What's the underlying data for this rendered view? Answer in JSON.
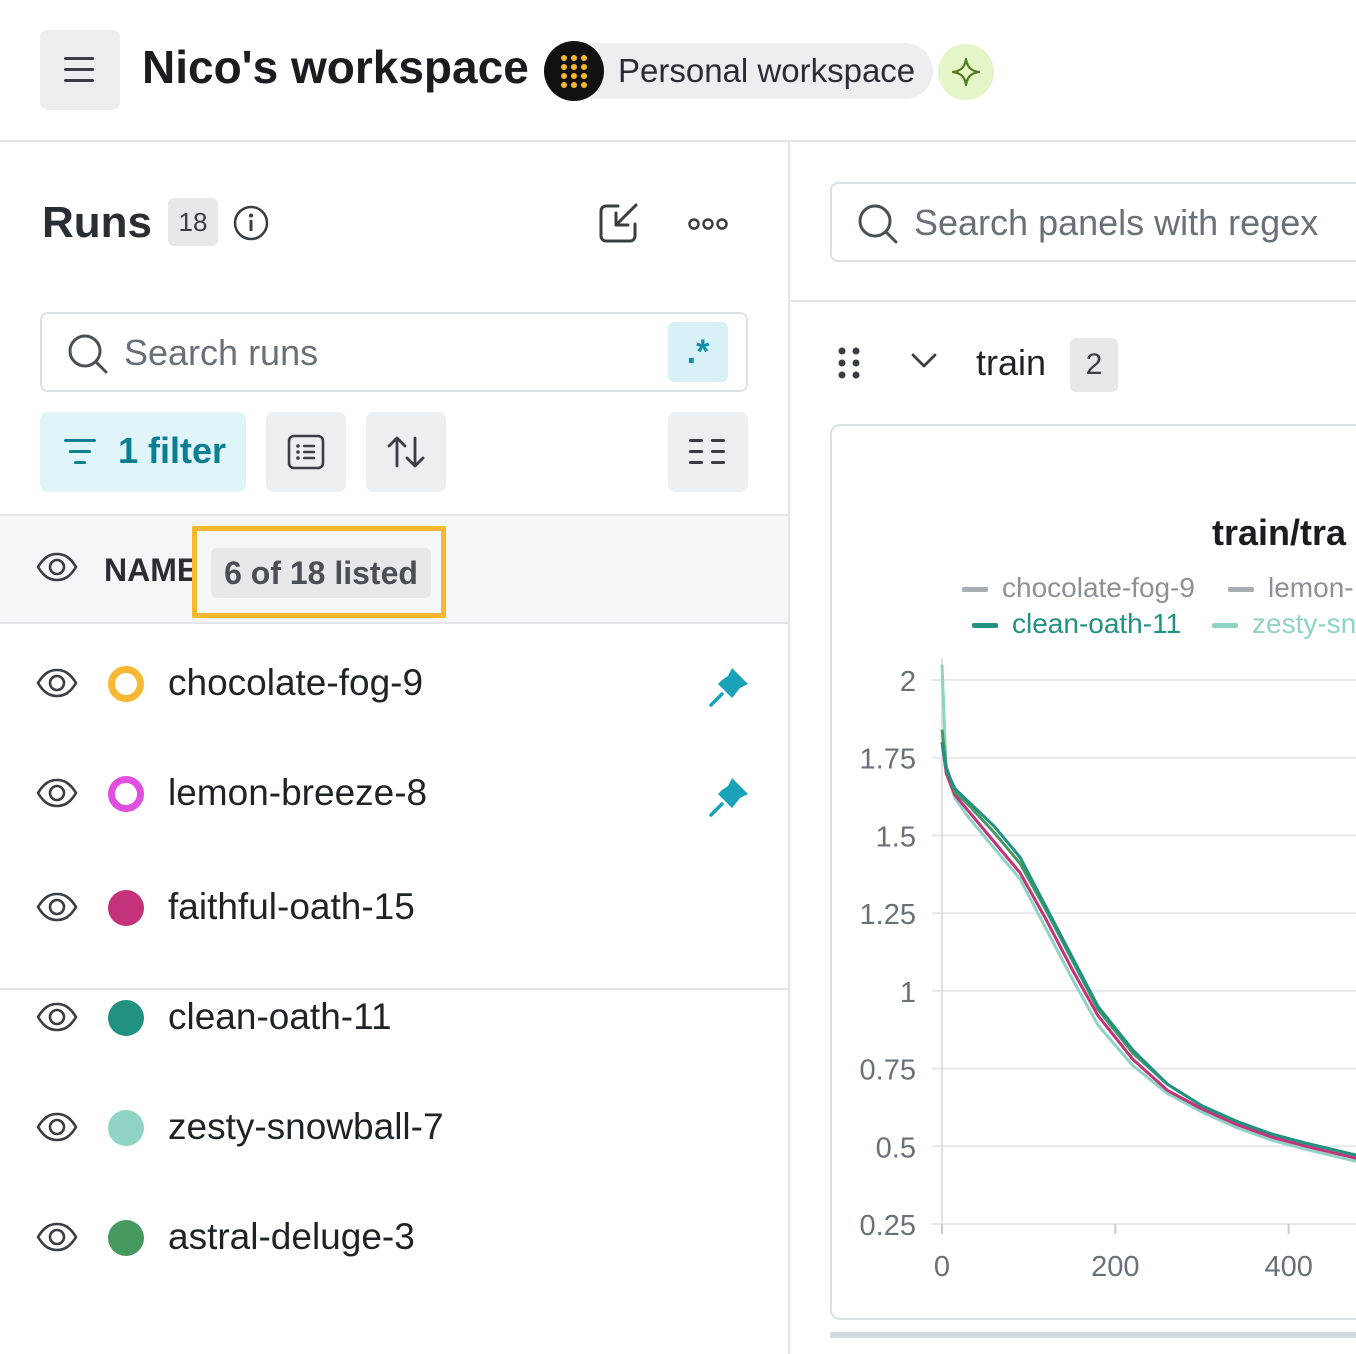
{
  "header": {
    "workspace_title": "Nico's workspace",
    "workspace_type": "Personal workspace"
  },
  "runs_panel": {
    "title": "Runs",
    "count": "18",
    "search_placeholder": "Search runs",
    "regex_label": ".*",
    "filter_label": "1 filter",
    "name_column": "NAME",
    "listed_badge": "6 of 18 listed",
    "runs": [
      {
        "name": "chocolate-fog-9",
        "color": "#f7b731",
        "style": "ring",
        "pinned": true
      },
      {
        "name": "lemon-breeze-8",
        "color": "#e04fe0",
        "style": "ring",
        "pinned": true
      },
      {
        "name": "faithful-oath-15",
        "color": "#c3327a",
        "style": "solid",
        "pinned": false
      },
      {
        "name": "clean-oath-11",
        "color": "#219181",
        "style": "solid",
        "pinned": false
      },
      {
        "name": "zesty-snowball-7",
        "color": "#8fd3c4",
        "style": "solid",
        "pinned": false
      },
      {
        "name": "astral-deluge-3",
        "color": "#479a5f",
        "style": "solid",
        "pinned": false
      }
    ]
  },
  "panels": {
    "search_placeholder": "Search panels with regex",
    "section_label": "train",
    "section_count": "2"
  },
  "chart_data": {
    "type": "line",
    "title": "train/tra",
    "legend": [
      {
        "name": "chocolate-fog-9",
        "color": "#a9adb3"
      },
      {
        "name": "lemon-",
        "color": "#a9adb3"
      },
      {
        "name": "clean-oath-11",
        "color": "#219181"
      },
      {
        "name": "zesty-sn",
        "color": "#8fd3c4"
      }
    ],
    "y_ticks": [
      "2",
      "1.75",
      "1.5",
      "1.25",
      "1",
      "0.75",
      "0.5",
      "0.25"
    ],
    "x_ticks": [
      "0",
      "200",
      "400"
    ],
    "xlim": [
      0,
      600
    ],
    "ylim": [
      0.25,
      2
    ],
    "series": [
      {
        "name": "zesty-snowball-7",
        "color": "#8fd3c4",
        "points": [
          [
            0,
            2.05
          ],
          [
            5,
            1.7
          ],
          [
            15,
            1.62
          ],
          [
            30,
            1.56
          ],
          [
            60,
            1.46
          ],
          [
            90,
            1.36
          ],
          [
            120,
            1.2
          ],
          [
            150,
            1.04
          ],
          [
            180,
            0.89
          ],
          [
            220,
            0.76
          ],
          [
            260,
            0.67
          ],
          [
            300,
            0.61
          ],
          [
            340,
            0.56
          ],
          [
            380,
            0.52
          ],
          [
            420,
            0.49
          ],
          [
            480,
            0.45
          ],
          [
            600,
            0.39
          ]
        ]
      },
      {
        "name": "faithful-oath-15",
        "color": "#c3327a",
        "points": [
          [
            0,
            1.8
          ],
          [
            5,
            1.7
          ],
          [
            15,
            1.63
          ],
          [
            30,
            1.58
          ],
          [
            60,
            1.48
          ],
          [
            90,
            1.38
          ],
          [
            120,
            1.23
          ],
          [
            150,
            1.07
          ],
          [
            180,
            0.92
          ],
          [
            220,
            0.78
          ],
          [
            260,
            0.68
          ],
          [
            300,
            0.62
          ],
          [
            340,
            0.57
          ],
          [
            380,
            0.53
          ],
          [
            420,
            0.5
          ],
          [
            480,
            0.46
          ],
          [
            600,
            0.4
          ]
        ]
      },
      {
        "name": "astral-deluge-3",
        "color": "#479a5f",
        "points": [
          [
            0,
            1.84
          ],
          [
            5,
            1.72
          ],
          [
            15,
            1.64
          ],
          [
            30,
            1.6
          ],
          [
            60,
            1.51
          ],
          [
            90,
            1.41
          ],
          [
            120,
            1.26
          ],
          [
            150,
            1.1
          ],
          [
            180,
            0.94
          ],
          [
            220,
            0.8
          ],
          [
            260,
            0.7
          ],
          [
            300,
            0.63
          ],
          [
            340,
            0.58
          ],
          [
            380,
            0.54
          ],
          [
            420,
            0.51
          ],
          [
            480,
            0.47
          ],
          [
            600,
            0.41
          ]
        ]
      },
      {
        "name": "clean-oath-11",
        "color": "#219181",
        "points": [
          [
            0,
            1.8
          ],
          [
            5,
            1.71
          ],
          [
            15,
            1.65
          ],
          [
            30,
            1.61
          ],
          [
            60,
            1.53
          ],
          [
            90,
            1.43
          ],
          [
            120,
            1.27
          ],
          [
            150,
            1.11
          ],
          [
            180,
            0.95
          ],
          [
            220,
            0.81
          ],
          [
            260,
            0.7
          ],
          [
            300,
            0.63
          ],
          [
            340,
            0.58
          ],
          [
            380,
            0.54
          ],
          [
            420,
            0.51
          ],
          [
            480,
            0.47
          ],
          [
            600,
            0.41
          ]
        ]
      }
    ]
  }
}
